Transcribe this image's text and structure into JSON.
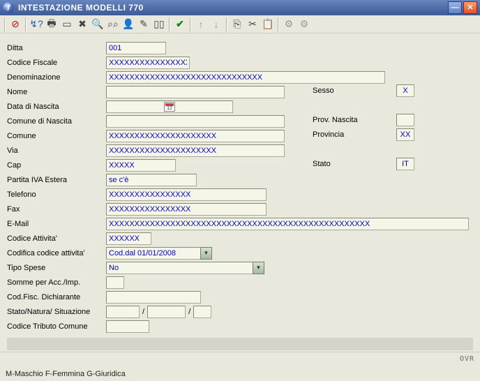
{
  "window": {
    "title": "INTESTAZIONE MODELLI 770"
  },
  "labels": {
    "ditta": "Ditta",
    "codfisc": "Codice Fiscale",
    "denom": "Denominazione",
    "nome": "Nome",
    "sesso": "Sesso",
    "datan": "Data di Nascita",
    "comnas": "Comune di Nascita",
    "provnas": "Prov. Nascita",
    "comune": "Comune",
    "provincia": "Provincia",
    "via": "Via",
    "cap": "Cap",
    "stato": "Stato",
    "piva": "Partita IVA Estera",
    "tel": "Telefono",
    "fax": "Fax",
    "email": "E-Mail",
    "codatt": "Codice Attivita'",
    "codattcod": "Codifica codice attivita'",
    "tipospese": "Tipo Spese",
    "somme": "Somme per Acc./Imp.",
    "codfiscd": "Cod.Fisc. Dichiarante",
    "stnatsit": "Stato/Natura/ Situazione",
    "codtrib": "Codice Tributo Comune"
  },
  "values": {
    "ditta": "001",
    "codfisc": "XXXXXXXXXXXXXXXX",
    "denom": "XXXXXXXXXXXXXXXXXXXXXXXXXXXXXX",
    "nome": "",
    "sesso": "X",
    "datan": "",
    "comnas": "",
    "provnas": "",
    "comune": "XXXXXXXXXXXXXXXXXXXXX",
    "provincia": "XX",
    "via": "XXXXXXXXXXXXXXXXXXXXX",
    "cap": "XXXXX",
    "stato": "IT",
    "piva": "se c'è",
    "tel": "XXXXXXXXXXXXXXXX",
    "fax": "XXXXXXXXXXXXXXXX",
    "email": "XXXXXXXXXXXXXXXXXXXXXXXXXXXXXXXXXXXXXXXXXXXXXXXXXXX",
    "codatt": "XXXXXX",
    "codattcod": "Cod.dal 01/01/2008",
    "tipospese": "No",
    "somme": "",
    "codfiscd": "",
    "st1": "",
    "st2": "",
    "st3": "",
    "codtrib": ""
  },
  "status": {
    "mode": "OVR"
  },
  "footer": {
    "hint": "M-Maschio F-Femmina G-Giuridica"
  }
}
